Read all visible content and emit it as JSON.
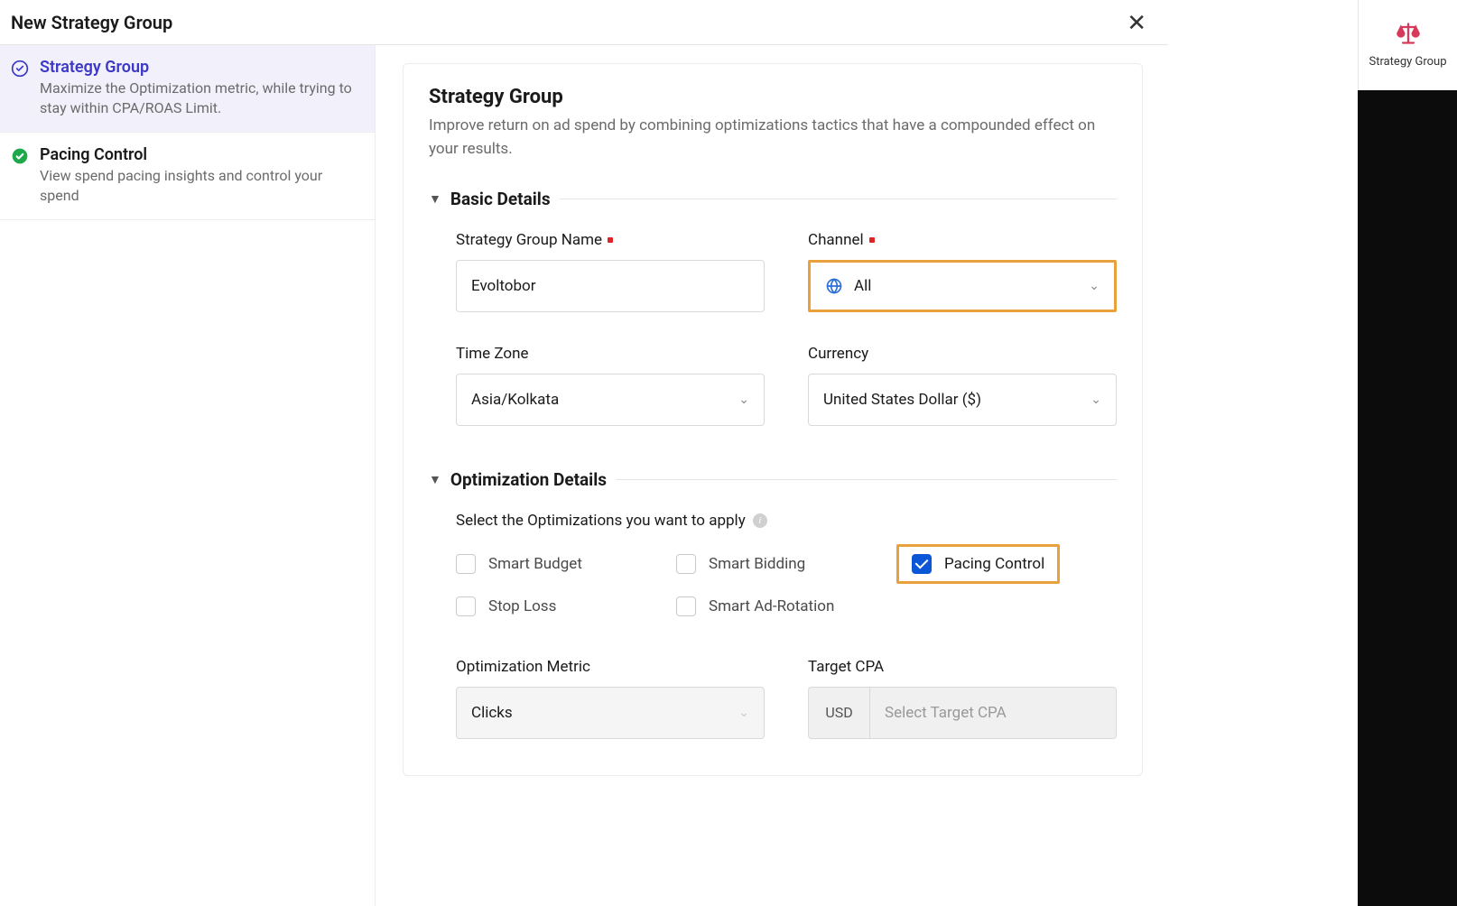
{
  "header": {
    "title": "New Strategy Group"
  },
  "rightRail": {
    "label": "Strategy Group"
  },
  "steps": [
    {
      "title": "Strategy Group",
      "desc": "Maximize the Optimization metric, while trying to stay within CPA/ROAS Limit.",
      "active": true
    },
    {
      "title": "Pacing Control",
      "desc": "View spend pacing insights and control your spend",
      "active": false
    }
  ],
  "main": {
    "title": "Strategy Group",
    "subtitle": "Improve return on ad spend by combining optimizations tactics that have a compounded effect on your results."
  },
  "sections": {
    "basic": "Basic Details",
    "optimization": "Optimization Details"
  },
  "basic": {
    "nameLabel": "Strategy Group Name",
    "nameValue": "Evoltobor",
    "channelLabel": "Channel",
    "channelValue": "All",
    "timezoneLabel": "Time Zone",
    "timezoneValue": "Asia/Kolkata",
    "currencyLabel": "Currency",
    "currencyValue": "United States Dollar ($)"
  },
  "optimization": {
    "prompt": "Select the Optimizations you want to apply",
    "options": {
      "smartBudget": "Smart Budget",
      "smartBidding": "Smart Bidding",
      "pacingControl": "Pacing Control",
      "stopLoss": "Stop Loss",
      "smartAdRotation": "Smart Ad-Rotation"
    },
    "metricLabel": "Optimization Metric",
    "metricValue": "Clicks",
    "cpaLabel": "Target CPA",
    "cpaPrefix": "USD",
    "cpaPlaceholder": "Select Target CPA"
  }
}
